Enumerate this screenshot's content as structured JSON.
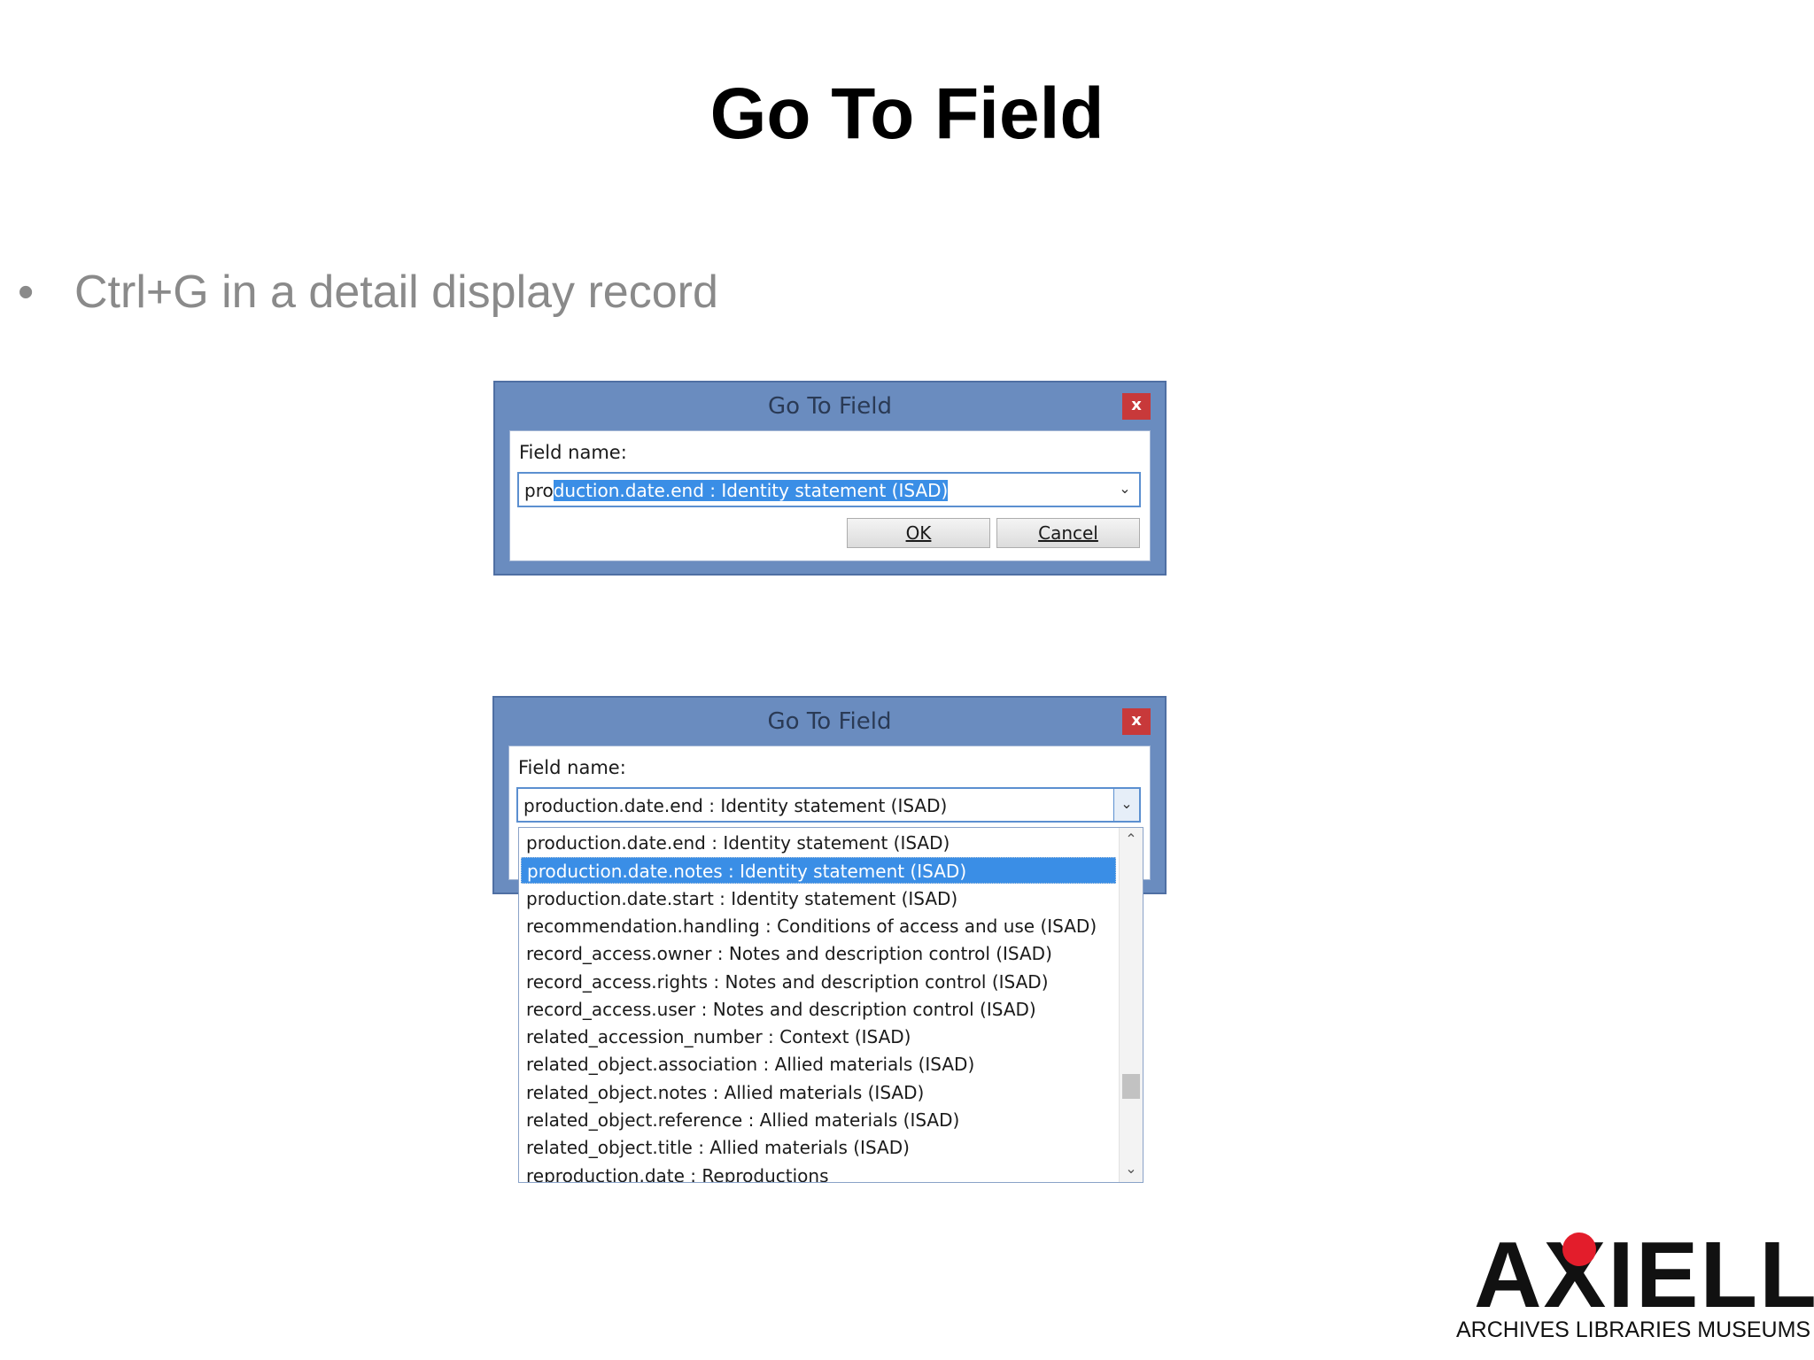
{
  "slide": {
    "title": "Go To Field",
    "bullet_char": "•",
    "bullet_text": "Ctrl+G in a detail display record"
  },
  "dialog_top": {
    "title": "Go To Field",
    "close_label": "x",
    "field_label": "Field name:",
    "field_value_unselected": "pro",
    "field_value_selected": "duction.date.end : Identity statement (ISAD)",
    "dropdown_icon": "chevron-down-icon",
    "ok_label": "OK",
    "cancel_label": "Cancel"
  },
  "dialog_bottom": {
    "title": "Go To Field",
    "close_label": "x",
    "field_label": "Field name:",
    "field_value": "production.date.end : Identity statement (ISAD)",
    "dropdown_icon": "chevron-down-icon",
    "list_items": [
      "production.date.end : Identity statement (ISAD)",
      "production.date.notes : Identity statement (ISAD)",
      "production.date.start : Identity statement (ISAD)",
      "recommendation.handling : Conditions of access and use (ISAD)",
      "record_access.owner : Notes and description control (ISAD)",
      "record_access.rights : Notes and description control (ISAD)",
      "record_access.user : Notes and description control (ISAD)",
      "related_accession_number : Context (ISAD)",
      "related_object.association : Allied materials (ISAD)",
      "related_object.notes : Allied materials (ISAD)",
      "related_object.reference : Allied materials (ISAD)",
      "related_object.title : Allied materials (ISAD)",
      "reproduction.date : Reproductions"
    ],
    "selected_index": 1,
    "scroll_up_icon": "chevron-up-icon",
    "scroll_down_icon": "chevron-down-icon"
  },
  "logo": {
    "wordmark": "AXIELL",
    "tagline": "ARCHIVES LIBRARIES MUSEUMS",
    "accent_color": "#e31d2b"
  },
  "colors": {
    "titlebar": "#6a8cbf",
    "selection": "#3a8ee6",
    "bullet_text": "#8a8a8a"
  }
}
